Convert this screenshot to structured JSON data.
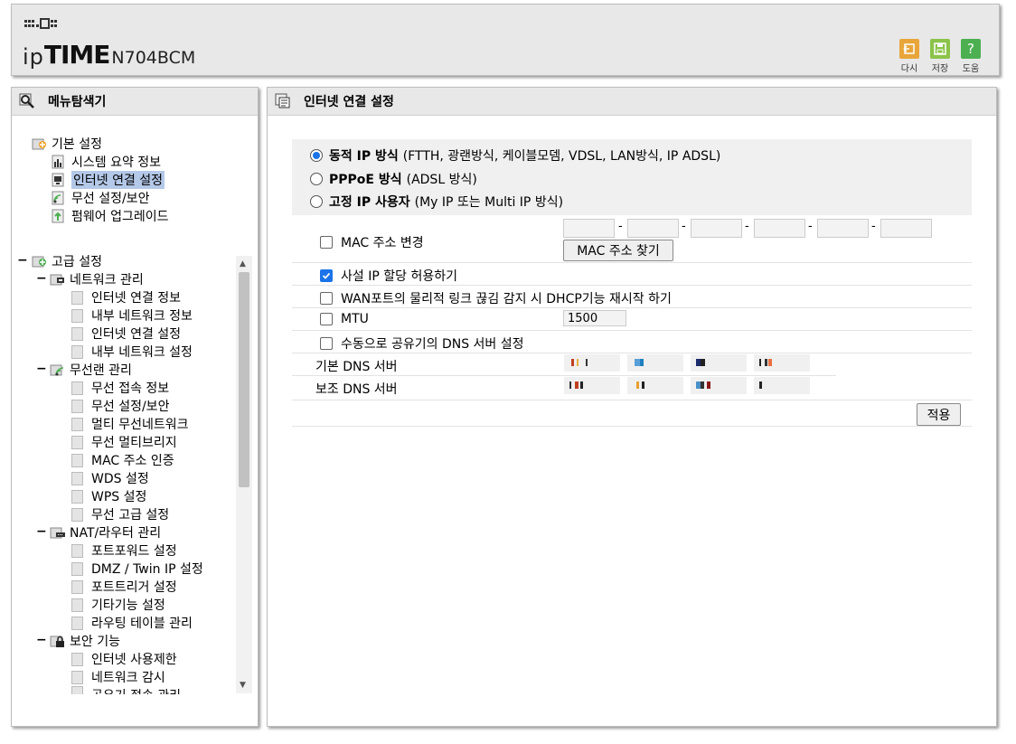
{
  "header": {
    "logo_ip": "ip",
    "logo_time": "TIME",
    "model": "N704BCM",
    "buttons": [
      {
        "label": "다시",
        "icon": "undo-icon",
        "color": "#e8a53a"
      },
      {
        "label": "저장",
        "icon": "save-icon",
        "color": "#8bc34a"
      },
      {
        "label": "도움",
        "icon": "help-icon",
        "color": "#4caf50"
      }
    ]
  },
  "sidebar": {
    "title": "메뉴탐색기",
    "basic": {
      "label": "기본 설정",
      "items": [
        "시스템 요약 정보",
        "인터넷 연결 설정",
        "무선 설정/보안",
        "펌웨어 업그레이드"
      ],
      "selected": "인터넷 연결 설정"
    },
    "advanced": {
      "label": "고급 설정",
      "groups": [
        {
          "label": "네트워크 관리",
          "items": [
            "인터넷 연결 정보",
            "내부 네트워크 정보",
            "인터넷 연결 설정",
            "내부 네트워크 설정"
          ]
        },
        {
          "label": "무선랜 관리",
          "items": [
            "무선 접속 정보",
            "무선 설정/보안",
            "멀티 무선네트워크",
            "무선 멀티브리지",
            "MAC 주소 인증",
            "WDS 설정",
            "WPS 설정",
            "무선 고급 설정"
          ]
        },
        {
          "label": "NAT/라우터 관리",
          "items": [
            "포트포워드 설정",
            "DMZ / Twin IP 설정",
            "포트트리거 설정",
            "기타기능 설정",
            "라우팅 테이블 관리"
          ]
        },
        {
          "label": "보안 기능",
          "items": [
            "인터넷 사용제한",
            "네트워크 감시",
            "공유기 접속 관리"
          ]
        }
      ]
    }
  },
  "main": {
    "title": "인터넷 연결 설정",
    "modes": [
      {
        "bold": "동적 IP 방식",
        "rest": "(FTTH, 광랜방식, 케이블모뎀, VDSL, LAN방식, IP ADSL)",
        "selected": true
      },
      {
        "bold": "PPPoE 방식",
        "rest": "(ADSL 방식)",
        "selected": false
      },
      {
        "bold": "고정 IP 사용자",
        "rest": "(My IP 또는 Multi IP 방식)",
        "selected": false
      }
    ],
    "mac_change_label": "MAC 주소 변경",
    "mac_find_button": "MAC 주소 찾기",
    "private_ip_label": "사설 IP 할당 허용하기",
    "wan_detect_label": "WAN포트의 물리적 링크 끊김 감지 시 DHCP기능 재시작 하기",
    "mtu_label": "MTU",
    "mtu_value": "1500",
    "manual_dns_label": "수동으로 공유기의 DNS 서버 설정",
    "primary_dns_label": "기본 DNS 서버",
    "secondary_dns_label": "보조 DNS 서버",
    "apply_button": "적용",
    "checkbox_state": {
      "mac_change": false,
      "private_ip": true,
      "wan_detect": false,
      "mtu": false,
      "manual_dns": false
    }
  }
}
